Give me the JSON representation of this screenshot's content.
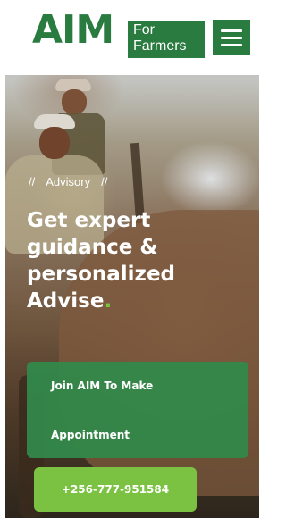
{
  "header": {
    "logo_text": "AIM",
    "logo_box_line1": "For",
    "logo_box_line2": "Farmers",
    "menu_icon": "hamburger-menu-icon"
  },
  "breadcrumb": {
    "separator_left": "//",
    "current": "Advisory",
    "separator_right": "//"
  },
  "hero": {
    "line1": "Get expert",
    "line2": "guidance &",
    "line3": "personalized",
    "line4": "Advise",
    "line4_dot": "."
  },
  "cta": {
    "line1": "Join AIM To Make",
    "line2": "Appointment"
  },
  "phone": {
    "label": "+256-777-951584"
  },
  "colors": {
    "brand_green": "#2a7b3f",
    "cta_green": "#33874a",
    "accent_green": "#7cc242"
  }
}
